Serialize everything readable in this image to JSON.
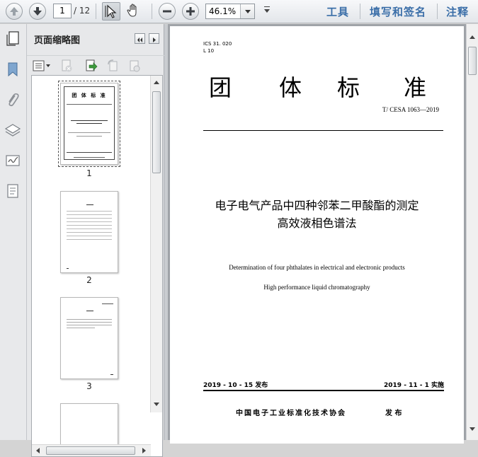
{
  "toolbar": {
    "current_page": "1",
    "total_pages": "/ 12",
    "zoom": "46.1%",
    "tools_label": "工具",
    "sign_label": "填写和签名",
    "comment_label": "注释"
  },
  "icons": {
    "prev_page": "arrow-up-icon",
    "next_page": "arrow-down-icon",
    "select": "cursor-arrow-icon",
    "hand": "hand-icon",
    "zoom_out": "minus-icon",
    "zoom_in": "plus-icon"
  },
  "thumb_panel": {
    "title": "页面缩略图",
    "pages": [
      {
        "num": "1",
        "title_chars": "团  体  标  准"
      },
      {
        "num": "2"
      },
      {
        "num": "3"
      }
    ]
  },
  "document": {
    "ics": "ICS 31. 020",
    "class_code": "L 10",
    "heading_chars": [
      "团",
      "体",
      "标",
      "准"
    ],
    "standard_no": "T/ CESA 1063—2019",
    "title_cn_line1": "电子电气产品中四种邻苯二甲酸酯的测定",
    "title_cn_line2": "高效液相色谱法",
    "title_en_line1": "Determination of four phthalates in electrical and electronic products",
    "title_en_line2": "High performance liquid chromatography",
    "issue_date": "2019 - 10 - 15 发布",
    "impl_date": "2019 - 11 - 1 实施",
    "publisher": "中国电子工业标准化技术协会",
    "publish_word": "发  布"
  },
  "colors": {
    "toolbar_link": "#3a6ea8",
    "viewer_bg": "#9fa3a8"
  }
}
